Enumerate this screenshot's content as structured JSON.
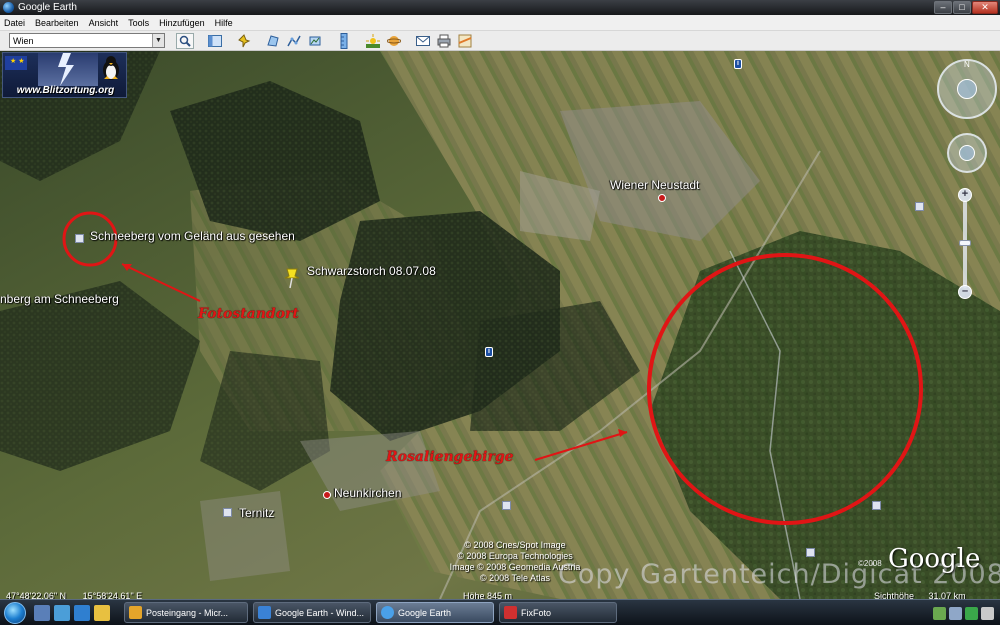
{
  "window": {
    "title": "Google Earth",
    "controls": {
      "minimize": "–",
      "maximize": "□",
      "close": "✕"
    }
  },
  "menu": [
    "Datei",
    "Bearbeiten",
    "Ansicht",
    "Tools",
    "Hinzufügen",
    "Hilfe"
  ],
  "toolbar": {
    "search_value": "Wien",
    "buttons": [
      "sidebar-icon",
      "placemark-icon",
      "polygon-icon",
      "path-icon",
      "overlay-icon",
      "ruler-icon",
      "sunlight-icon",
      "sky-icon",
      "email-icon",
      "print-icon",
      "maps-icon"
    ]
  },
  "logo": {
    "text": "www.Blitzortung.org"
  },
  "map": {
    "labels": {
      "schneeberg_view": "Schneeberg vom Geländ aus gesehen",
      "schwarzstorch": "Schwarzstorch 08.07.08",
      "schneeberg_mountain": "nberg am Schneeberg",
      "wiener_neustadt": "Wiener Neustadt",
      "neunkirchen": "Neunkirchen",
      "ternitz": "Ternitz"
    },
    "annotations": {
      "fotostandort": "Fotostandort",
      "rosaliengebirge": "Rosaliengebirge"
    },
    "colors": {
      "annotation": "#e01515"
    },
    "copyright": [
      "© 2008 Cnes/Spot Image",
      "© 2008 Europa Technologies",
      "Image © 2008 Geomedia Austria",
      "© 2008 Tele Atlas"
    ],
    "watermark": "Copy Gartenteich/Digicat 2008",
    "google_logo": "Google",
    "google_year": "©2008"
  },
  "status": {
    "latitude": "47°48'22.06\" N",
    "longitude": "15°58'24.61\" E",
    "elevation": "Höhe 845 m",
    "eye_alt_label": "Sichthöhe",
    "eye_alt_value": "31.07 km"
  },
  "taskbar": {
    "tasks": [
      {
        "label": "Posteingang - Micr...",
        "color": "#e5a52a"
      },
      {
        "label": "Google Earth - Wind...",
        "color": "#3a82d6"
      },
      {
        "label": "Google Earth",
        "color": "#4aa0e8"
      },
      {
        "label": "FixFoto",
        "color": "#d03030"
      }
    ]
  }
}
